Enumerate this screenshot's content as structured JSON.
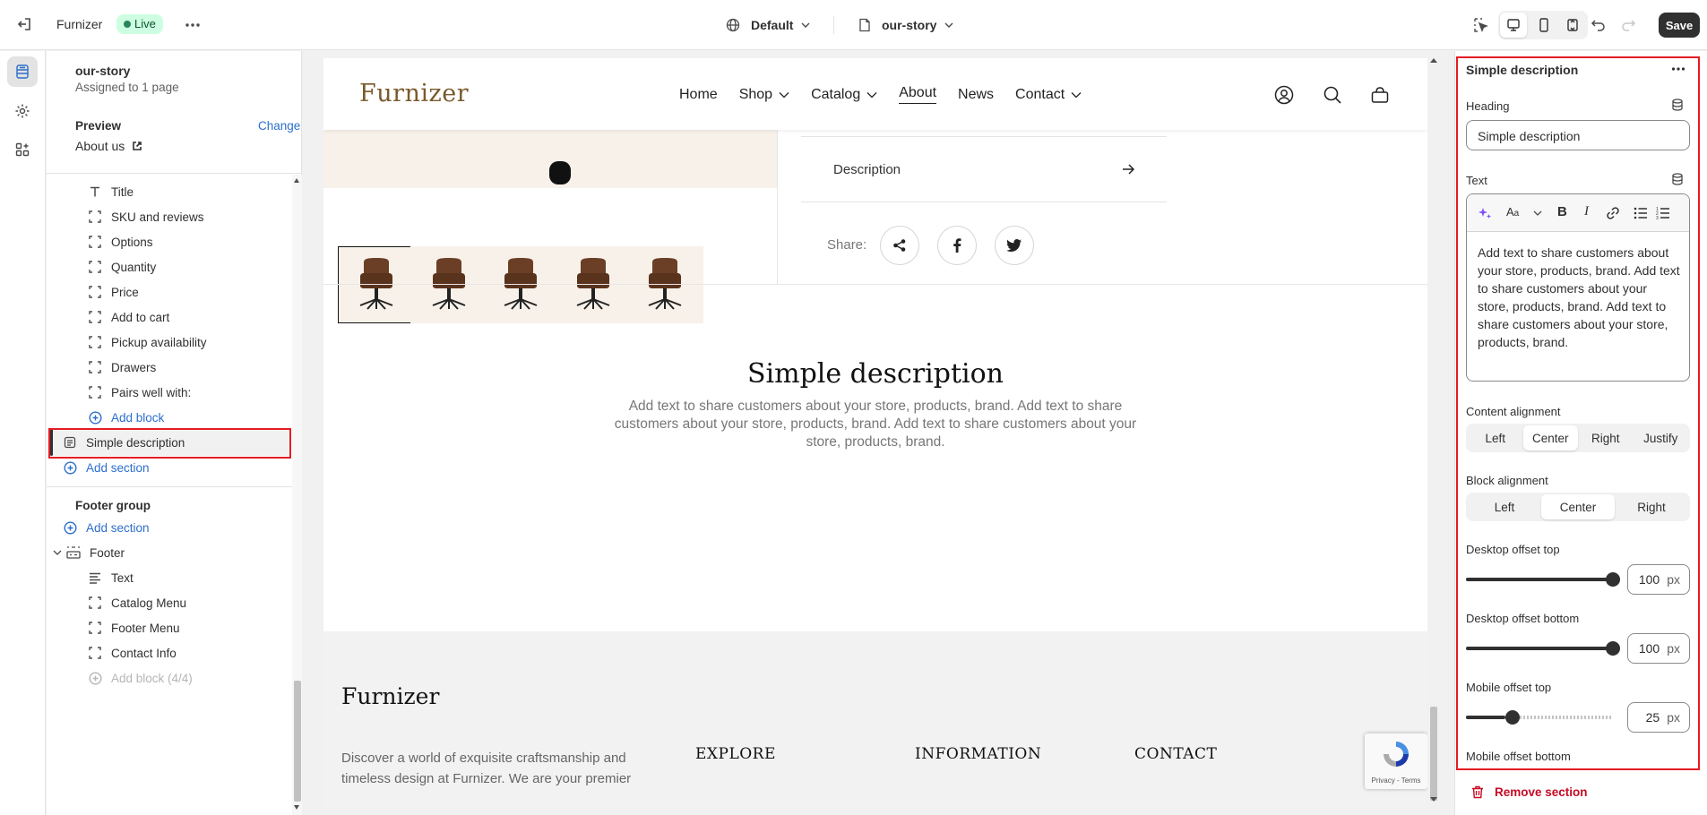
{
  "topbar": {
    "store_name": "Furnizer",
    "status_badge": "Live",
    "theme_select": "Default",
    "page_select": "our-story",
    "save_label": "Save"
  },
  "left_panel": {
    "template_name": "our-story",
    "assigned": "Assigned to 1 page",
    "preview_label": "Preview",
    "change_label": "Change",
    "preview_page": "About us",
    "blocks": [
      {
        "label": "Title",
        "icon": "text-icon"
      },
      {
        "label": "SKU and reviews",
        "icon": "block-icon"
      },
      {
        "label": "Options",
        "icon": "block-icon"
      },
      {
        "label": "Quantity",
        "icon": "block-icon"
      },
      {
        "label": "Price",
        "icon": "block-icon"
      },
      {
        "label": "Add to cart",
        "icon": "block-icon"
      },
      {
        "label": "Pickup availability",
        "icon": "block-icon"
      },
      {
        "label": "Drawers",
        "icon": "block-icon"
      },
      {
        "label": "Pairs well with:",
        "icon": "block-icon"
      }
    ],
    "add_block": "Add block",
    "selected_section": "Simple description",
    "add_section": "Add section",
    "footer_group": "Footer group",
    "footer_add_section": "Add section",
    "footer": "Footer",
    "footer_blocks": [
      "Text",
      "Catalog Menu",
      "Footer Menu",
      "Contact Info"
    ],
    "footer_add_block": "Add block (4/4)"
  },
  "preview": {
    "logo": "Furnizer",
    "nav": [
      "Home",
      "Shop",
      "Catalog",
      "About",
      "News",
      "Contact"
    ],
    "description_row": "Description",
    "share_label": "Share:",
    "section_heading": "Simple description",
    "section_text": "Add text to share customers about your store, products, brand. Add text to share customers about your store, products, brand. Add text to share customers about your store, products, brand.",
    "footer_logo": "Furnizer",
    "footer_text": "Discover a world of exquisite craftsmanship and timeless design at Furnizer. We are your premier",
    "footer_cols": [
      "EXPLORE",
      "INFORMATION",
      "CONTACT"
    ],
    "recaptcha": "Privacy - Terms"
  },
  "settings": {
    "title": "Simple description",
    "heading_label": "Heading",
    "heading_value": "Simple description",
    "text_label": "Text",
    "text_value": "Add text to share customers about your store, products, brand. Add text to share customers about your store, products, brand. Add text to share customers about your store, products, brand.",
    "content_alignment_label": "Content alignment",
    "content_alignment": [
      "Left",
      "Center",
      "Right",
      "Justify"
    ],
    "content_alignment_selected": "Center",
    "block_alignment_label": "Block alignment",
    "block_alignment": [
      "Left",
      "Center",
      "Right"
    ],
    "block_alignment_selected": "Center",
    "desktop_top_label": "Desktop offset top",
    "desktop_top_value": "100",
    "desktop_bottom_label": "Desktop offset bottom",
    "desktop_bottom_value": "100",
    "mobile_top_label": "Mobile offset top",
    "mobile_top_value": "25",
    "mobile_bottom_label": "Mobile offset bottom",
    "unit": "px",
    "remove_section": "Remove section"
  },
  "colors": {
    "accent": "#2c6ecb",
    "highlight": "#e51c23",
    "live": "#cdfee1",
    "logo": "#7a5a2b"
  }
}
